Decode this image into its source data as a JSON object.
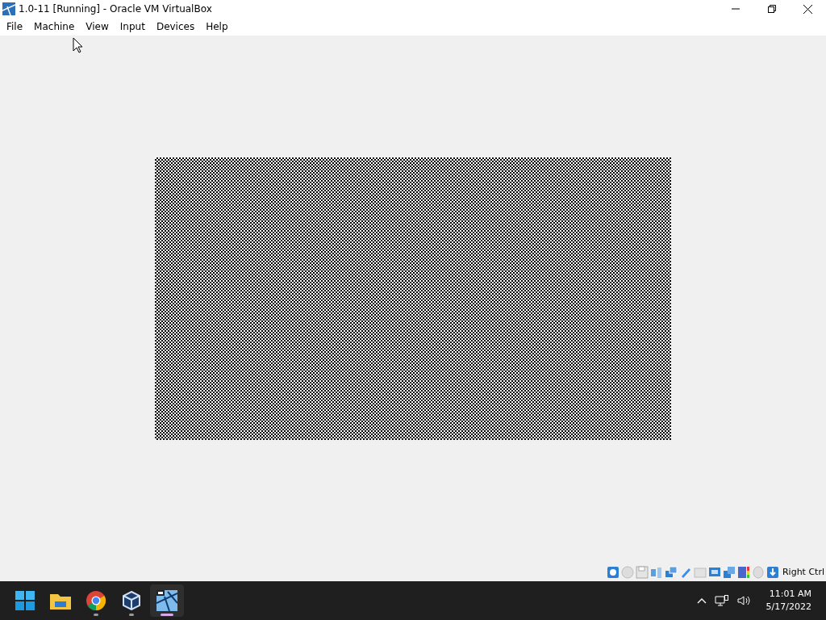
{
  "window": {
    "title": "1.0-11 [Running] - Oracle VM VirtualBox"
  },
  "menu": [
    "File",
    "Machine",
    "View",
    "Input",
    "Devices",
    "Help"
  ],
  "status_bar": {
    "host_key": "Right Ctrl"
  },
  "taskbar": {
    "apps": [
      {
        "kind": "start",
        "running": false,
        "selected": false
      },
      {
        "kind": "folder",
        "running": false,
        "selected": false
      },
      {
        "kind": "browser",
        "running": true,
        "selected": false
      },
      {
        "kind": "cube",
        "running": true,
        "selected": false
      },
      {
        "kind": "vm",
        "running": true,
        "selected": true
      }
    ],
    "time": "11:01 AM",
    "date": "5/17/2022"
  }
}
